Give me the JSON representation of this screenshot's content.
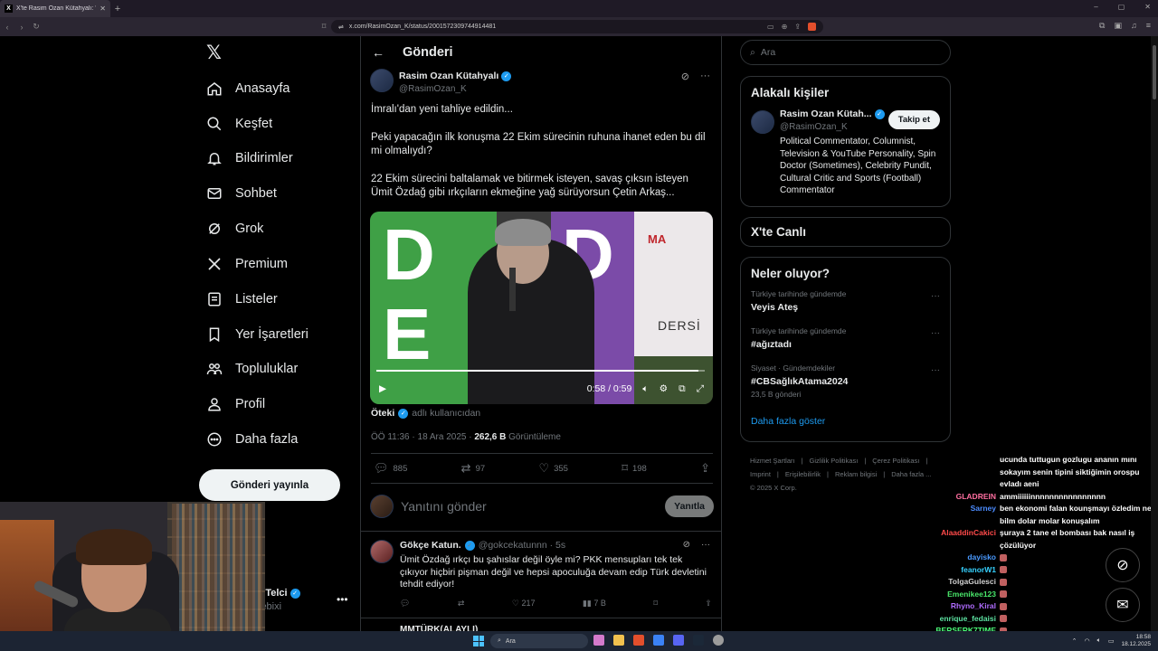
{
  "browser": {
    "tab_title": "X'te Rasim Ozan Kütahyalı: \"İmralı",
    "url": "x.com/RasimOzan_K/status/2001572309744914481"
  },
  "nav": {
    "items": [
      {
        "label": "Anasayfa",
        "icon": "home-icon"
      },
      {
        "label": "Keşfet",
        "icon": "search-icon"
      },
      {
        "label": "Bildirimler",
        "icon": "bell-icon"
      },
      {
        "label": "Sohbet",
        "icon": "mail-icon"
      },
      {
        "label": "Grok",
        "icon": "grok-icon"
      },
      {
        "label": "Premium",
        "icon": "x-icon"
      },
      {
        "label": "Listeler",
        "icon": "list-icon"
      },
      {
        "label": "Yer İşaretleri",
        "icon": "bookmark-icon"
      },
      {
        "label": "Topluluklar",
        "icon": "people-icon"
      },
      {
        "label": "Profil",
        "icon": "person-icon"
      },
      {
        "label": "Daha fazla",
        "icon": "more-icon"
      }
    ],
    "post_button": "Gönderi yayınla",
    "account_name": "r Telci",
    "account_handle": "lebixi"
  },
  "main": {
    "header": "Gönderi",
    "post": {
      "author": "Rasim Ozan Kütahyalı",
      "handle": "@RasimOzan_K",
      "paragraphs": [
        "İmralı'dan yeni tahliye edildin...",
        "Peki yapacağın ilk konuşma 22 Ekim sürecinin ruhuna ihanet eden bu dil mi olmalıydı?",
        "22 Ekim sürecini baltalamak ve bitirmek isteyen, savaş çıksın isteyen Ümit Özdağ gibi ırkçıların ekmeğine yağ sürüyorsun Çetin Arkaş..."
      ],
      "video": {
        "time": "0:58 / 0:59",
        "progress": 0.98,
        "logo": "MA",
        "side_text": "DERSİ"
      },
      "viewed_from_name": "Öteki",
      "viewed_from_text": "adlı kullanıcıdan",
      "time": "ÖÖ 11:36 · 18 Ara 2025 · ",
      "views": "262,6 B",
      "views_label": " Görüntüleme",
      "stats": {
        "replies": "885",
        "reposts": "97",
        "likes": "355",
        "bookmarks": "198"
      }
    },
    "reply_placeholder": "Yanıtını gönder",
    "reply_button": "Yanıtla",
    "reply": {
      "author": "Gökçe Katun.",
      "handle": "@gokcekatunnn · 5s",
      "text": "Ümit Özdağ ırkçı bu şahıslar değil öyle mi? PKK mensupları tek tek çıkıyor hiçbiri pişman değil ve hepsi apoculuğa devam edip Türk devletini tehdit ediyor!",
      "likes": "217",
      "views": "7 B"
    },
    "next_post_author": "MMTÜRK(ALAYLI)"
  },
  "right": {
    "search_placeholder": "Ara",
    "related_title": "Alakalı kişiler",
    "related": {
      "name": "Rasim Ozan Kütah...",
      "handle": "@RasimOzan_K",
      "bio": "Political Commentator, Columnist, Television & YouTube Personality, Spin Doctor (Sometimes), Celebrity Pundit, Cultural Critic and Sports (Football) Commentator",
      "follow": "Takip et"
    },
    "live_title": "X'te Canlı",
    "trends_title": "Neler oluyor?",
    "trends": [
      {
        "context": "Türkiye tarihinde gündemde",
        "title": "Veyis Ateş",
        "count": ""
      },
      {
        "context": "Türkiye tarihinde gündemde",
        "title": "#ağıztadı",
        "count": ""
      },
      {
        "context": "Siyaset · Gündemdekiler",
        "title": "#CBSağlıkAtama2024",
        "count": "23,5 B gönderi"
      }
    ],
    "show_more": "Daha fazla göster",
    "footer": [
      "Hizmet Şartları",
      "|",
      "Gizlilik Politikası",
      "|",
      "Çerez Politikası",
      "|",
      "Imprint",
      "|",
      "Erişilebilirlik",
      "|",
      "Reklam bilgisi",
      "|",
      "Daha fazla ...",
      "© 2025 X Corp."
    ]
  },
  "chat": [
    {
      "user": "",
      "msg": "ucunda tuttugun gozlugu ananın mını sokayım senin tipini siktiğimin orospu evladı aeni",
      "color": "#ffffff"
    },
    {
      "user": "GLADREIN",
      "msg": "ammiiiiiinnnnnnnnnnnnnnnn",
      "color": "#ff6fa0"
    },
    {
      "user": "Sarney",
      "msg": "ben ekonomi falan kounşmayı özledim ne bilm dolar molar konuşalım",
      "color": "#4c8cff"
    },
    {
      "user": "AlaaddinCakici",
      "msg": "şuraya 2 tane el bombası bak nasıl iş çözülüyor",
      "color": "#ff4a4a"
    },
    {
      "user": "dayisko",
      "msg": "",
      "color": "#4a9aff"
    },
    {
      "user": "feanorW1",
      "msg": "",
      "color": "#36d1ff"
    },
    {
      "user": "TolgaGulesci",
      "msg": "",
      "color": "#d0d0d0"
    },
    {
      "user": "Emenikee123",
      "msg": "",
      "color": "#49e76a"
    },
    {
      "user": "Rhyno_Kiral",
      "msg": "",
      "color": "#b06cff"
    },
    {
      "user": "enrique_fedaisi",
      "msg": "",
      "color": "#5ce0a0"
    },
    {
      "user": "BERSERK7TIME",
      "msg": "",
      "color": "#4cff7a"
    }
  ],
  "taskbar": {
    "search": "Ara",
    "time": "18:58",
    "date": "18.12.2025"
  },
  "colors": {
    "accent": "#1d9bf0",
    "bg": "#000000",
    "border": "#2f3336",
    "muted": "#71767b"
  }
}
